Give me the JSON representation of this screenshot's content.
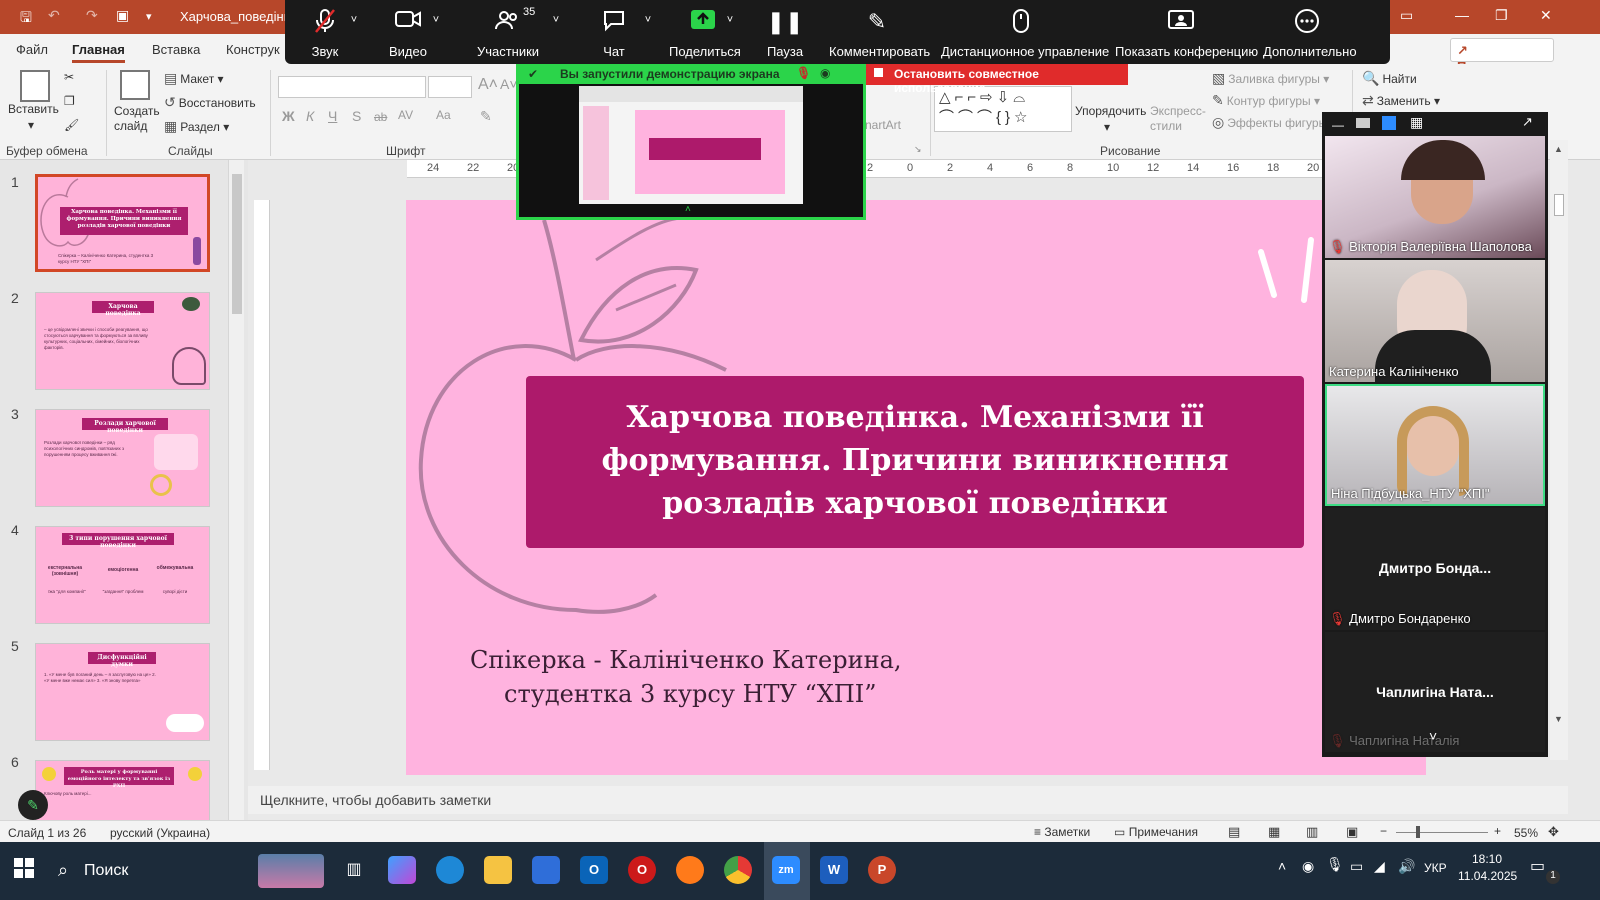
{
  "app": {
    "title": "Харчова_поведінка",
    "share_label": "Поделиться"
  },
  "menu": [
    "Файл",
    "Главная",
    "Вставка",
    "Конструк"
  ],
  "ribbon": {
    "paste": "Вставить",
    "create_slide": "Создать слайд",
    "layout": "Макет",
    "restore": "Восстановить",
    "section": "Раздел",
    "group_clipboard": "Буфер обмена",
    "group_slides": "Слайды",
    "group_font": "Шрифт",
    "group_drawing": "Рисование",
    "arrange": "Упорядочить",
    "express_styles": "Экспресс-стили",
    "fill": "Заливка фигуры",
    "outline": "Контур фигуры",
    "effects": "Эффекты фигуры",
    "find": "Найти",
    "replace": "Заменить",
    "smartart": "nartArt",
    "font_buttons": [
      "Ж",
      "К",
      "Ч",
      "S",
      "ab",
      "AV",
      "Aa"
    ]
  },
  "zoom": {
    "buttons": [
      {
        "label": "Звук",
        "icon": "mic-muted-icon"
      },
      {
        "label": "Видео",
        "icon": "video-icon"
      },
      {
        "label": "Участники",
        "icon": "participants-icon",
        "count": "35"
      },
      {
        "label": "Чат",
        "icon": "chat-icon"
      },
      {
        "label": "Поделиться",
        "icon": "share-icon"
      },
      {
        "label": "Пауза",
        "icon": "pause-icon"
      },
      {
        "label": "Комментировать",
        "icon": "pencil-icon"
      },
      {
        "label": "Дистанционное управление",
        "icon": "mouse-icon"
      },
      {
        "label": "Показать конференцию",
        "icon": "monitor-icon"
      },
      {
        "label": "Дополнительно",
        "icon": "more-icon"
      }
    ],
    "share_banner": "Вы запустили демонстрацию экрана",
    "stop_share": "Остановить совместное использование"
  },
  "slides": [
    {
      "num": "1",
      "title": "Харчова поведінка. Механізми її формування. Причини виникнення розладів харчової поведінки",
      "text": "Спікерка – Калініченко Катерина, студентка 3 курсу НТУ \"ХПІ\""
    },
    {
      "num": "2",
      "title": "Харчова поведінка",
      "text": "– це усвідомлені звички і способи реагування, що стосуються харчування та формуються за впливу культурних, соціальних, сімейних, біологічних факторів."
    },
    {
      "num": "3",
      "title": "Розлади харчової поведінки",
      "text": "Розлади харчової поведінки – ряд психологічних синдромів, пов'язаних з порушенням процесу вживання їжі."
    },
    {
      "num": "4",
      "title": "3 типи порушення харчової поведінки",
      "cols": [
        "екстернальна (зовнішня)",
        "емоціогенна",
        "обмежувальна"
      ],
      "subs": [
        "їжа \"для компанії\"",
        "\"заїдання\" проблем",
        "суворі дієти"
      ]
    },
    {
      "num": "5",
      "title": "Дисфункційні думки",
      "text": "1. «У мене був поганий день – я заслуговую на це» 2. «У мене вже немає сил» 3. «Я знову переїла»"
    },
    {
      "num": "6",
      "title": "Роль матері у формуванні емоційного інтелекту та зв'язок із РХП",
      "text": "Ключову роль матері..."
    }
  ],
  "main_slide": {
    "title": "Харчова поведінка. Механізми її формування. Причини виникнення розладів харчової поведінки",
    "speaker_line1": "Спікерка - Калініченко Катерина,",
    "speaker_line2": "студентка 3 курсу НТУ “ХПІ”"
  },
  "participants": [
    {
      "name": "Вікторія Валеріївна Шаполова",
      "video": true,
      "muted": true
    },
    {
      "name": "Катерина Калініченко",
      "video": true,
      "muted": false
    },
    {
      "name": "Ніна Підбуцька_НТУ \"ХПІ\"",
      "video": true,
      "muted": false,
      "active": true
    },
    {
      "short": "Дмитро  Бонда...",
      "name": "Дмитро Бондаренко",
      "video": false,
      "muted": true
    },
    {
      "short": "Чаплигіна  Ната...",
      "name": "Чаплигіна Наталія",
      "video": false,
      "muted": true
    }
  ],
  "notes_placeholder": "Щелкните, чтобы добавить заметки",
  "status": {
    "slide_count": "Слайд 1 из 26",
    "language": "русский (Украина)",
    "notes": "Заметки",
    "comments": "Примечания",
    "zoom": "55%"
  },
  "taskbar": {
    "search": "Поиск",
    "lang": "УКР",
    "time": "18:10",
    "date": "11.04.2025",
    "notif": "1"
  },
  "colors": {
    "accent": "#b7472a",
    "slide_bg": "#ffb3df",
    "title_box": "#ad1a6b",
    "zoom_green": "#2bd44a",
    "stop_red": "#e02b2b"
  }
}
